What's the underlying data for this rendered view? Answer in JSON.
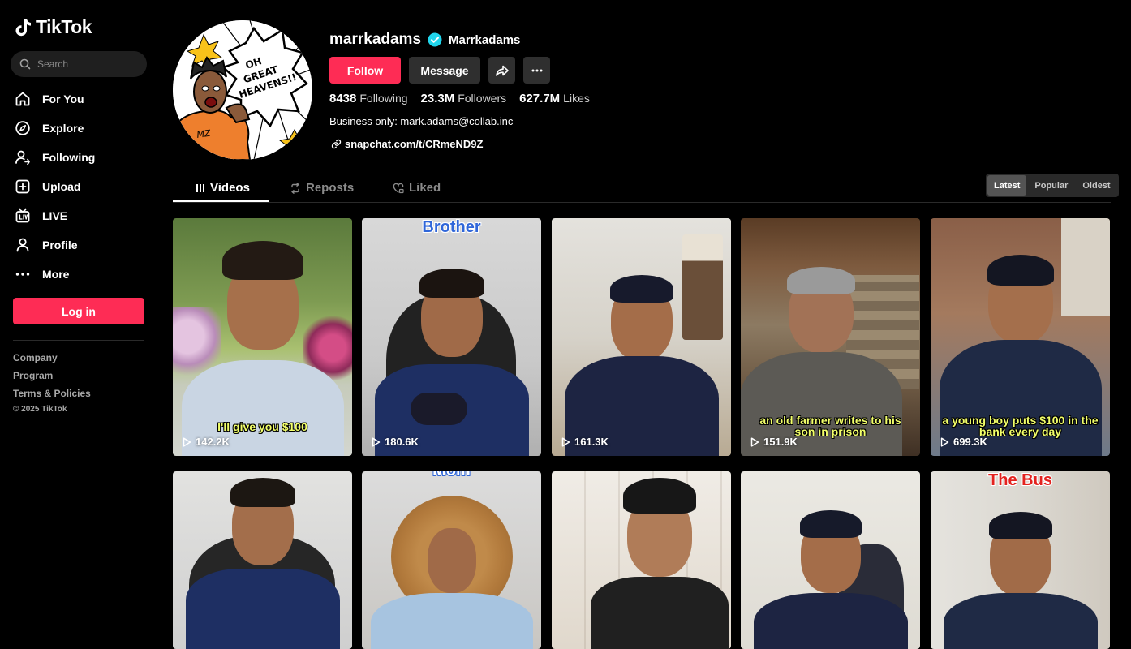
{
  "app": {
    "name": "TikTok"
  },
  "search": {
    "placeholder": "Search"
  },
  "nav": [
    {
      "label": "For You",
      "icon": "home-icon"
    },
    {
      "label": "Explore",
      "icon": "compass-icon"
    },
    {
      "label": "Following",
      "icon": "user-follow-icon"
    },
    {
      "label": "Upload",
      "icon": "plus-square-icon"
    },
    {
      "label": "LIVE",
      "icon": "live-tv-icon"
    },
    {
      "label": "Profile",
      "icon": "user-icon"
    },
    {
      "label": "More",
      "icon": "more-dots-icon"
    }
  ],
  "login_label": "Log in",
  "footer": {
    "links": [
      "Company",
      "Program",
      "Terms & Policies"
    ],
    "copyright": "© 2025 TikTok"
  },
  "profile": {
    "username": "marrkadams",
    "nickname": "Marrkadams",
    "verified": true,
    "follow_label": "Follow",
    "message_label": "Message",
    "avatar_text": "OH GREAT HEAVENS!!",
    "avatar_monogram": "MZ",
    "stats": {
      "following_count": "8438",
      "following_label": "Following",
      "followers_count": "23.3M",
      "followers_label": "Followers",
      "likes_count": "627.7M",
      "likes_label": "Likes"
    },
    "bio": "Business only: mark.adams@collab.inc",
    "link": "snapchat.com/t/CRmeND9Z"
  },
  "tabs": [
    {
      "label": "Videos",
      "icon": "grid-icon",
      "active": true
    },
    {
      "label": "Reposts",
      "icon": "repost-icon",
      "active": false
    },
    {
      "label": "Liked",
      "icon": "heart-lock-icon",
      "active": false
    }
  ],
  "sort": [
    {
      "label": "Latest",
      "active": true
    },
    {
      "label": "Popular",
      "active": false
    },
    {
      "label": "Oldest",
      "active": false
    }
  ],
  "videos": [
    {
      "views": "142.2K",
      "caption": "I'll give you $100",
      "title": ""
    },
    {
      "views": "180.6K",
      "caption": "",
      "title": "Brother"
    },
    {
      "views": "161.3K",
      "caption": "",
      "title": ""
    },
    {
      "views": "151.9K",
      "caption": "an old farmer writes to his son in prison",
      "title": ""
    },
    {
      "views": "699.3K",
      "caption": "a young boy puts $100 in the bank every day",
      "title": ""
    },
    {
      "views": "",
      "caption": "",
      "title": ""
    },
    {
      "views": "",
      "caption": "",
      "title": "Mom"
    },
    {
      "views": "",
      "caption": "",
      "title": ""
    },
    {
      "views": "",
      "caption": "",
      "title": ""
    },
    {
      "views": "",
      "caption": "",
      "title": "The Bus"
    }
  ],
  "colors": {
    "brand": "#fe2c55",
    "verified": "#20d5ec",
    "caption": "#f2ff6a"
  }
}
